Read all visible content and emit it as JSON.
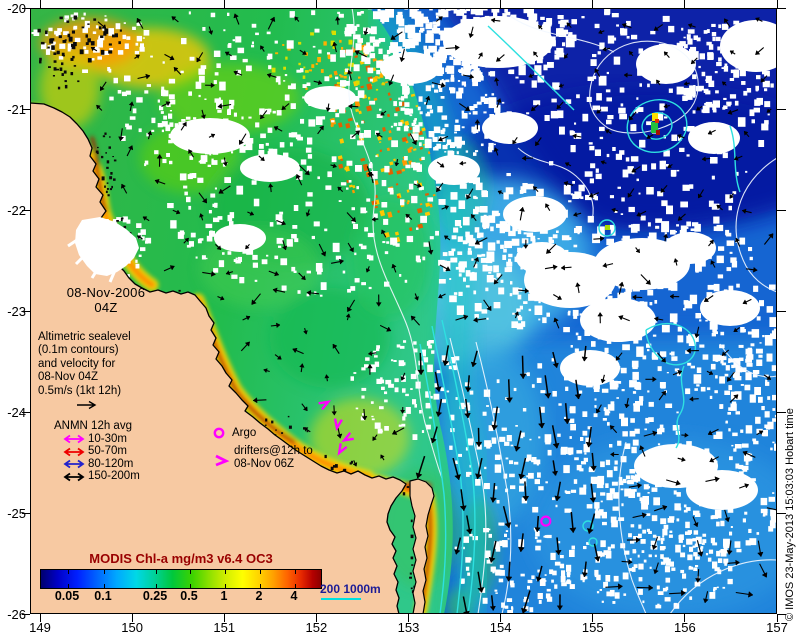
{
  "figure": {
    "credit": "© IMOS 23-May-2013 15:03:03 Hobart time"
  },
  "axes": {
    "lon_ticks": [
      "149",
      "150",
      "151",
      "152",
      "153",
      "154",
      "155",
      "156",
      "157"
    ],
    "lat_ticks": [
      "-20",
      "-21",
      "-22",
      "-23",
      "-24",
      "-25",
      "-26"
    ]
  },
  "annotations": {
    "date": {
      "line1": "08-Nov-2006",
      "line2": "04Z"
    },
    "altimetric_note": [
      "Altimetric sealevel",
      "(0.1m contours)",
      "and velocity for",
      "08-Nov 04Z",
      "0.5m/s (1kt 12h)"
    ],
    "anmn_legend": {
      "title": "ANMN 12h avg",
      "rows": [
        {
          "label": "10-30m",
          "color": "#ff00ff"
        },
        {
          "label": "50-70m",
          "color": "#ee0000"
        },
        {
          "label": "80-120m",
          "color": "#2222cc"
        },
        {
          "label": "150-200m",
          "color": "#000000"
        }
      ]
    },
    "argo_legend": {
      "label": "Argo",
      "marker_color": "#ff00ff"
    },
    "drifters_legend": {
      "line1": "drifters@12h to",
      "line2": "08-Nov 06Z",
      "marker_color": "#ff00ff"
    },
    "depth_scale": {
      "label": "200  1000m",
      "text_color": "#1c1c96",
      "line_color": "#00e0e0"
    }
  },
  "colorbar": {
    "title": "MODIS Chl-a mg/m3 v6.4 OC3",
    "title_color": "#990000",
    "tick_labels": [
      "0.05",
      "0.1",
      "0.25",
      "0.5",
      "1",
      "2",
      "4"
    ]
  },
  "map_markers": {
    "argo_floats": [
      {
        "lon": 154.49,
        "lat": -25.08
      }
    ],
    "drifters": [
      {
        "lon": 152.09,
        "lat": -23.92,
        "heading_deg": -30
      },
      {
        "lon": 152.23,
        "lat": -24.12,
        "heading_deg": 100
      },
      {
        "lon": 152.34,
        "lat": -24.26,
        "heading_deg": 150
      },
      {
        "lon": 152.27,
        "lat": -24.37,
        "heading_deg": 120
      }
    ]
  },
  "palette": {
    "land": "#f7c9a2",
    "cloud": "#ffffff",
    "deep_ocean": "#0a20a8",
    "shelf_blue": "#1f7fd6",
    "chl_green": "#2fc24a",
    "chl_yellow": "#ffd900",
    "chl_orange": "#ff8800",
    "chl_dark_red": "#a02800",
    "contour_cyan": "#2ee0e0",
    "contour_white": "#f2f8ff",
    "vector_black": "#000000"
  }
}
